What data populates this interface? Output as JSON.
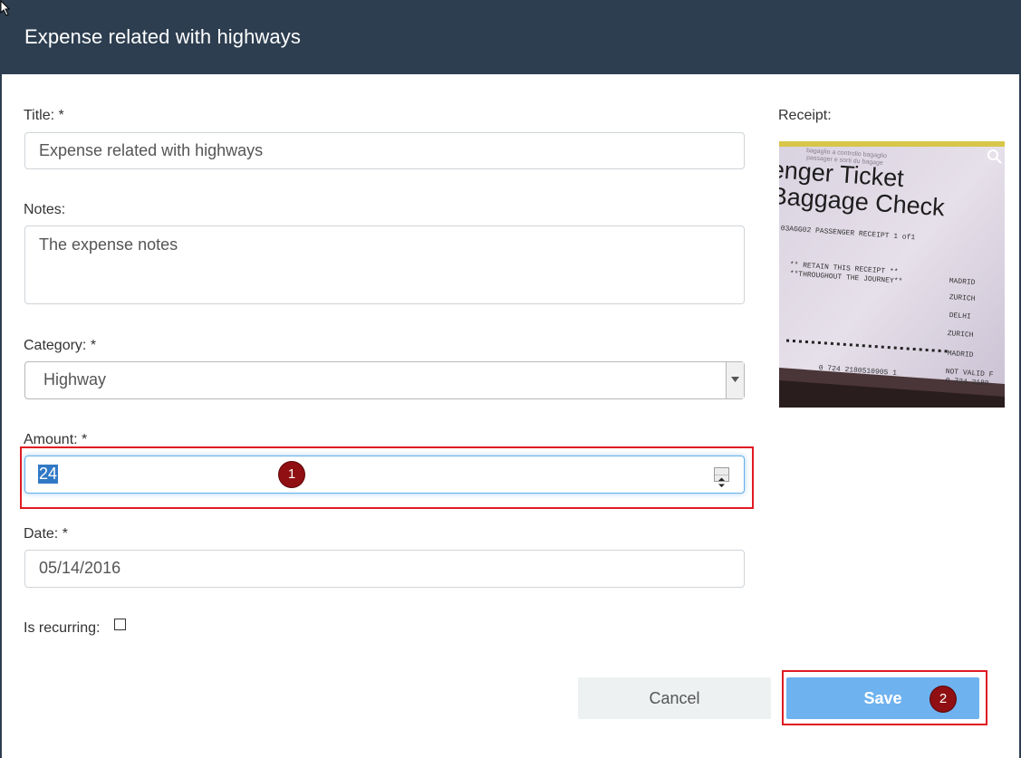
{
  "dialog": {
    "title": "Expense related with highways"
  },
  "form": {
    "title": {
      "label": "Title: *",
      "value": "Expense related with highways"
    },
    "notes": {
      "label": "Notes:",
      "value": "The expense notes"
    },
    "category": {
      "label": "Category: *",
      "selected": "Highway"
    },
    "amount": {
      "label": "Amount: *",
      "value": "24"
    },
    "date": {
      "label": "Date: *",
      "value": "05/14/2016"
    },
    "recurring": {
      "label": "Is recurring:",
      "checked": false
    }
  },
  "receipt": {
    "label": "Receipt:",
    "image_text": {
      "line1": "enger Ticket",
      "line2": "Baggage Check",
      "receipt_line": "03AGG02 PASSENGER RECEIPT 1 of1",
      "retain1": "** RETAIN THIS RECEIPT **",
      "retain2": "**THROUGHOUT THE JOURNEY**",
      "city1": "MADRID",
      "city2": "ZURICH",
      "city3": "DELHI",
      "city4": "ZURICH",
      "city5": "MADRID",
      "notvalid": "NOT VALID F",
      "number": "0 724 2180510905 1",
      "number2": "0 724 2180"
    }
  },
  "actions": {
    "cancel": "Cancel",
    "save": "Save"
  },
  "annotations": {
    "badge1": "1",
    "badge2": "2",
    "highlight_color": "#e01b22"
  }
}
